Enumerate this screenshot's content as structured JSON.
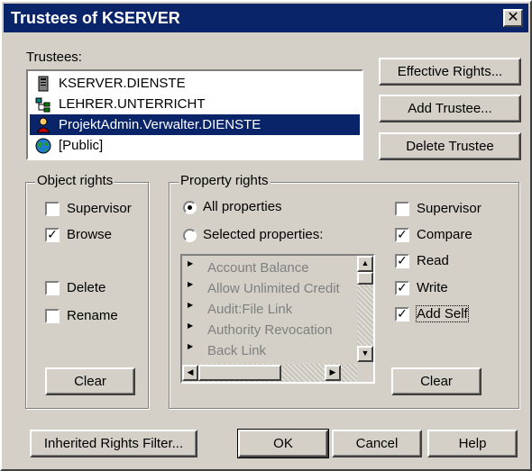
{
  "window": {
    "title": "Trustees of KSERVER",
    "close_glyph": "✕"
  },
  "trustees": {
    "label": "Trustees:",
    "items": [
      {
        "name": "KSERVER.DIENSTE",
        "icon": "server-icon",
        "selected": false
      },
      {
        "name": "LEHRER.UNTERRICHT",
        "icon": "org-unit-icon",
        "selected": false
      },
      {
        "name": "ProjektAdmin.Verwalter.DIENSTE",
        "icon": "user-icon",
        "selected": true
      },
      {
        "name": "[Public]",
        "icon": "globe-icon",
        "selected": false
      }
    ]
  },
  "buttons": {
    "effective_rights": "Effective Rights...",
    "add_trustee": "Add Trustee...",
    "delete_trustee": "Delete Trustee",
    "object_clear": "Clear",
    "property_clear": "Clear",
    "inherited_rights_filter": "Inherited Rights Filter...",
    "ok": "OK",
    "cancel": "Cancel",
    "help": "Help"
  },
  "object_rights": {
    "title": "Object rights",
    "supervisor": {
      "label": "Supervisor",
      "checked": false
    },
    "browse": {
      "label": "Browse",
      "checked": true
    },
    "delete": {
      "label": "Delete",
      "checked": false
    },
    "rename": {
      "label": "Rename",
      "checked": false
    }
  },
  "property_rights": {
    "title": "Property rights",
    "all_properties": {
      "label": "All properties",
      "selected": true
    },
    "selected_properties": {
      "label": "Selected properties:",
      "selected": false
    },
    "list": [
      "Account Balance",
      "Allow Unlimited Credit",
      "Audit:File Link",
      "Authority Revocation",
      "Back Link"
    ],
    "supervisor": {
      "label": "Supervisor",
      "checked": false
    },
    "compare": {
      "label": "Compare",
      "checked": true
    },
    "read": {
      "label": "Read",
      "checked": true
    },
    "write": {
      "label": "Write",
      "checked": true
    },
    "add_self": {
      "label": "Add Self",
      "checked": true
    }
  },
  "check_glyph": "✓",
  "colors": {
    "title_bar": "#0a246a",
    "selection": "#0a246a",
    "face": "#d4d0c8"
  }
}
